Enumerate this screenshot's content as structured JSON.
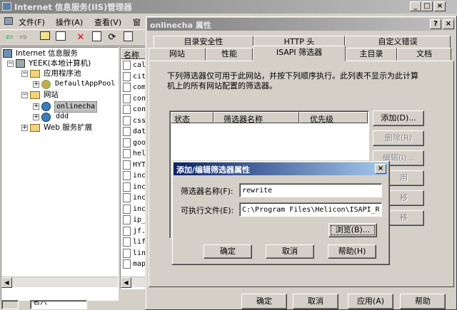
{
  "iis_window": {
    "title": "Internet 信息服务(IIS)管理器",
    "menu": [
      "文件(F)",
      "操作(A)",
      "查看(V)",
      "窗"
    ],
    "tree": [
      {
        "label": "Internet 信息服务"
      },
      {
        "label": "YEEK(本地计算机)"
      },
      {
        "label": "应用程序池"
      },
      {
        "label": "DefaultAppPool"
      },
      {
        "label": "网站"
      },
      {
        "label": "onlinecha"
      },
      {
        "label": "ddd"
      },
      {
        "label": "Web 服务扩展"
      }
    ],
    "list_header": "名称",
    "list_items": [
      "cal",
      "cit",
      "com",
      "con",
      "con",
      "css",
      "dat",
      "goo",
      "hel",
      "HYT",
      "inc",
      "inc",
      "inc",
      "inc",
      "ip_",
      "jf.",
      "lif",
      "lin",
      "map"
    ],
    "status_text": "名六"
  },
  "props_window": {
    "title": "onlinecha 属性",
    "help_glyph": "?",
    "close_glyph": "×",
    "tabs_row1": [
      "目录安全性",
      "HTTP 头",
      "自定义错误"
    ],
    "tabs_row2": [
      "网站",
      "性能",
      "ISAPI 筛选器",
      "主目录",
      "文档"
    ],
    "description": "下列筛选器仅可用于此网站，并按下列顺序执行。此列表不显示为此计算机上的所有网站配置的筛选器。",
    "columns": [
      "状态",
      "筛选器名称",
      "优先级"
    ],
    "side_buttons": [
      "添加(D)...",
      "删除(R)",
      "编辑(I)...",
      "用",
      "移",
      "移"
    ],
    "footer_buttons": [
      "确定",
      "取消",
      "应用(A)",
      "帮助"
    ]
  },
  "add_dialog": {
    "title": "添加/编辑筛选器属性",
    "close_glyph": "×",
    "name_label": "筛选器名称(F):",
    "name_value": "rewrite",
    "exe_label": "可执行文件(E):",
    "exe_value": "C:\\Program Files\\Helicon\\ISAPI_Rewr",
    "browse_label": "浏览(B)...",
    "ok_label": "确定",
    "cancel_label": "取消",
    "help_label": "帮助(H)"
  },
  "colors": {
    "face": "#d4d0c8",
    "active_title": "#0a246a",
    "inactive_title": "#808080",
    "window": "#ffffff"
  }
}
